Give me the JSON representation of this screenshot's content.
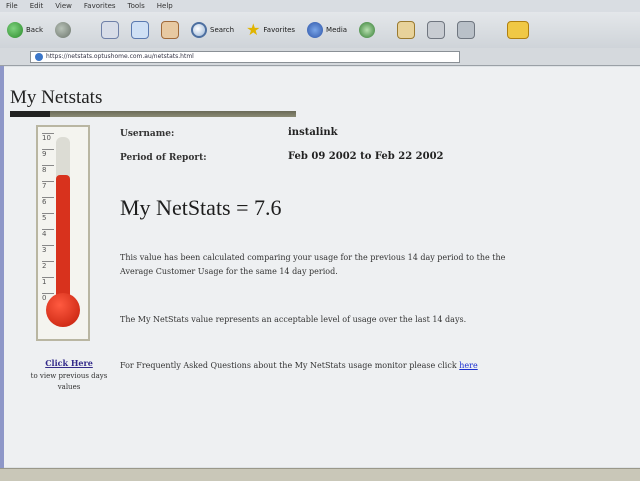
{
  "browser": {
    "menu": [
      "File",
      "Edit",
      "View",
      "Favorites",
      "Tools",
      "Help"
    ],
    "toolbar": {
      "back_label": "Back",
      "search_label": "Search",
      "favorites_label": "Favorites",
      "media_label": "Media"
    },
    "address": "https://netstats.optushome.com.au/netstats.html"
  },
  "page": {
    "title": "My Netstats",
    "username_label": "Username:",
    "username_value": "instalink",
    "period_label": "Period of Report:",
    "period_value": "Feb 09 2002 to Feb 22 2002",
    "score_heading": "My NetStats = 7.6",
    "score_value": 7.6,
    "scale_max": 10,
    "scale_ticks": [
      "10",
      "9",
      "8",
      "7",
      "6",
      "5",
      "4",
      "3",
      "2",
      "1",
      "0"
    ],
    "paragraph1": "This value has been calculated comparing your usage for the previous 14 day period to the the Average Customer Usage for the same 14 day period.",
    "paragraph2": "The My NetStats value represents an acceptable level of usage over the last 14 days.",
    "paragraph3_text": "For Frequently Asked Questions about the My NetStats usage monitor please click",
    "paragraph3_link": "here",
    "click_here_link": "Click Here",
    "click_here_desc": "to view previous days values"
  },
  "colors": {
    "thermometer_fill": "#d8321d",
    "link": "#1b2fd0"
  }
}
